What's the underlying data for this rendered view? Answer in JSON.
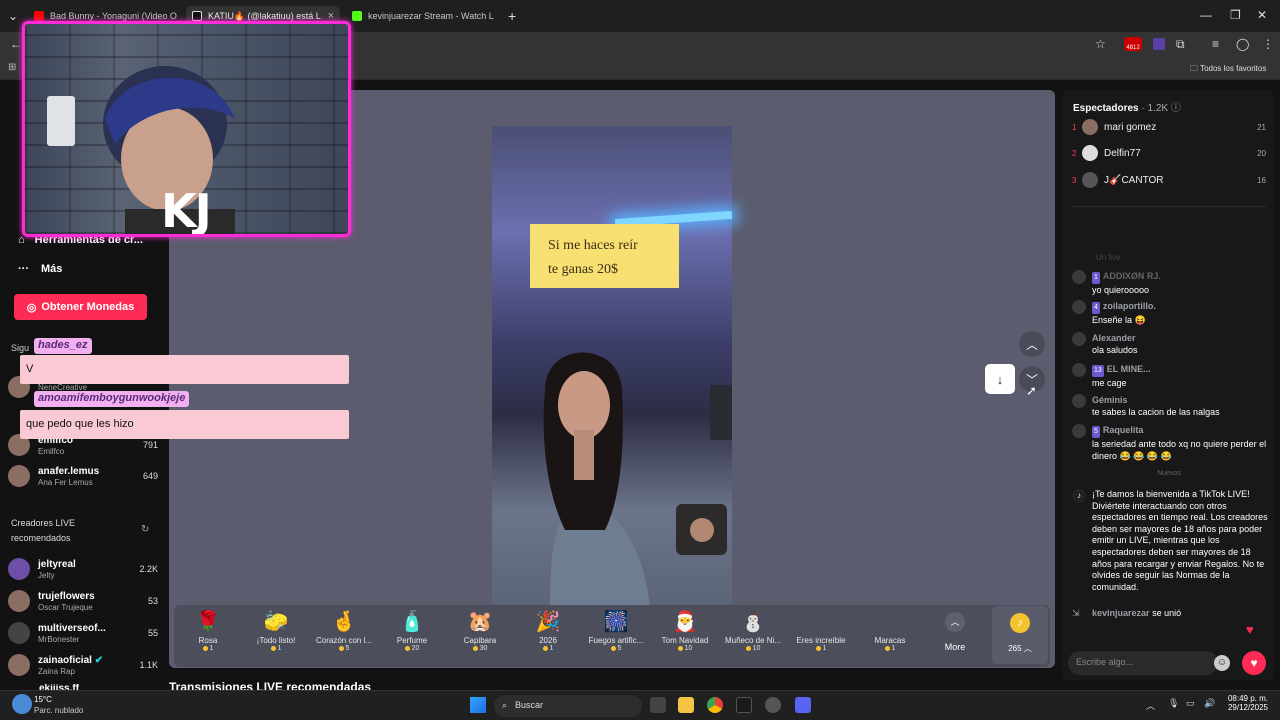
{
  "browser": {
    "tabs": [
      {
        "title": "Bad Bunny - Yonaguni (Video O",
        "icon": "youtube-icon",
        "color": "#ff0000"
      },
      {
        "title": "KATIU🔥 (@lakatiuu) está L",
        "icon": "tiktok-icon",
        "color": "#ffffff"
      },
      {
        "title": "kevinjuarezar Stream - Watch L",
        "icon": "kick-icon",
        "color": "#53fc18"
      }
    ],
    "new_tab": "+",
    "bookmarks_label": "Todos los favoritos",
    "ext_badge": "4812"
  },
  "sidebar": {
    "tools_label": "Herramientas de cr...",
    "more_label": "Más",
    "coins_button": "Obtener Monedas",
    "following_label": "Sigu",
    "following": [
      {
        "name": "",
        "sub": "NeneCreative",
        "count": ""
      },
      {
        "name": "emilfco",
        "sub": "Emilfco",
        "count": "791"
      },
      {
        "name": "anafer.lemus",
        "sub": "Ana Fer Lemus",
        "count": "649"
      }
    ],
    "recommended_title": "Creadores LIVE recomendados",
    "recommended": [
      {
        "name": "jeltyreal",
        "sub": "Jelty",
        "count": "2.2K"
      },
      {
        "name": "trujeflowers",
        "sub": "Oscar Trujeque",
        "count": "53"
      },
      {
        "name": "multiverseof...",
        "sub": "MrBonester",
        "count": "55"
      },
      {
        "name": "zainaoficial",
        "sub": "Zaina Rap",
        "count": "1.1K"
      },
      {
        "name": "ekiiiss.ff",
        "sub": "",
        "count": ""
      }
    ]
  },
  "overlay": {
    "webcam_label": "KJ",
    "chat": [
      {
        "user": "hades_ez",
        "message": "V"
      },
      {
        "user": "amoamifemboygunwookjeje",
        "message": "que pedo que les hizo"
      }
    ]
  },
  "stream": {
    "sign_text_line1": "Si me haces reír",
    "sign_text_line2": "te ganas 20$",
    "recommended_title": "Transmisiones LIVE recomendadas"
  },
  "gifts": [
    {
      "name": "Rosa",
      "price": "1",
      "icon": "🌹"
    },
    {
      "name": "¡Todo listo!",
      "price": "1",
      "icon": "🧽"
    },
    {
      "name": "Corazón con l...",
      "price": "5",
      "icon": "🤞"
    },
    {
      "name": "Perfume",
      "price": "20",
      "icon": "🧴"
    },
    {
      "name": "Capibara",
      "price": "30",
      "icon": "🐹"
    },
    {
      "name": "2026",
      "price": "1",
      "icon": "🎉"
    },
    {
      "name": "Fuegos artific...",
      "price": "5",
      "icon": "🎆"
    },
    {
      "name": "Tom Navidad",
      "price": "10",
      "icon": "🎅"
    },
    {
      "name": "Muñeco de Ni...",
      "price": "10",
      "icon": "⛄"
    },
    {
      "name": "Eres increíble",
      "price": "1",
      "icon": ""
    },
    {
      "name": "Maracas",
      "price": "1",
      "icon": ""
    }
  ],
  "gift_more": "More",
  "coin_balance": "265",
  "viewers_panel": {
    "title": "Espectadores",
    "count": "· 1.2K",
    "top": [
      {
        "rank": "1",
        "name": "mari gomez",
        "score": "21"
      },
      {
        "rank": "2",
        "name": "Delfin77",
        "score": "20"
      },
      {
        "rank": "3",
        "name": "J🎸CANTOR",
        "score": "16"
      }
    ]
  },
  "chat": {
    "faded_label": "Un live",
    "messages": [
      {
        "level": "1",
        "user": "ADDIXØN RJ.",
        "text": "yo quierooooo"
      },
      {
        "level": "4",
        "user": "zoilaportillo.",
        "text": "Enseñe la 😝"
      },
      {
        "level": "",
        "user": "Alexander",
        "text": "ola saludos"
      },
      {
        "level": "13",
        "user": "EL MINE...",
        "text": "me cage"
      },
      {
        "level": "",
        "user": "Géminis",
        "text": "te sabes la cacion de las nalgas"
      },
      {
        "level": "5",
        "user": "Raquelita",
        "text": "la seriedad ante todo xq no quiere perder el dinero 😂 😂 😂 😂"
      }
    ],
    "new_divider": "Nuevos",
    "welcome": "¡Te damos la bienvenida a TikTok LIVE! Diviértete interactuando con otros espectadores en tiempo real. Los creadores deben ser mayores de 18 años para poder emitir un LIVE, mientras que los espectadores deben ser mayores de 18 años para recargar y enviar Regalos. No te olvides de seguir las Normas de la comunidad.",
    "joined_user": "kevinjuarezar",
    "joined_text": "se unió",
    "input_placeholder": "Escribe algo..."
  },
  "taskbar": {
    "weather_temp": "15°C",
    "weather_desc": "Parc. nublado",
    "search_placeholder": "Buscar",
    "time": "08:49 p. m.",
    "date": "29/12/2025"
  }
}
